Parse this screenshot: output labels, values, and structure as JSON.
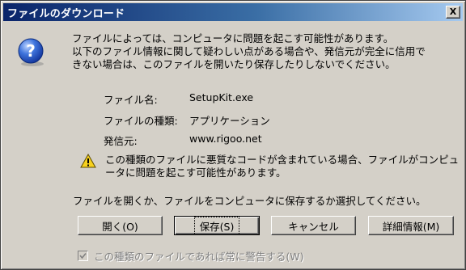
{
  "window": {
    "title": "ファイルのダウンロード",
    "close_label": "X"
  },
  "message": {
    "lines": [
      "ファイルによっては、コンピュータに問題を起こす可能性があります。",
      "以下のファイル情報に関して疑わしい点がある場合や、発信元が完全に信用で",
      "きない場合は、このファイルを開いたり保存したりしないでください。"
    ]
  },
  "file_info": {
    "name_label": "ファイル名:",
    "name_value": "SetupKit.exe",
    "type_label": "ファイルの種類:",
    "type_value": "アプリケーション",
    "source_label": "発信元:",
    "source_value": "www.rigoo.net"
  },
  "warning": {
    "lines": [
      "この種類のファイルに悪質なコードが含まれている場合、ファイルがコンピュ",
      "ータに問題を起こす可能性があります。"
    ]
  },
  "prompt": "ファイルを開くか、ファイルをコンピュータに保存するか選択してください。",
  "buttons": {
    "open": "開く(O)",
    "save": "保存(S)",
    "cancel": "キャンセル",
    "details": "詳細情報(M)"
  },
  "checkbox": {
    "label": "この種類のファイルであれば常に警告する(W)",
    "checked": true,
    "disabled": true
  },
  "icons": {
    "question": "question-icon",
    "warning": "warning-icon",
    "checkmark": "checkmark-icon"
  },
  "colors": {
    "title_start": "#0a246a",
    "title_end": "#a6caf0",
    "face": "#d4d0c8",
    "question_blue": "#1f4fb5",
    "warning_yellow": "#f7d11e"
  }
}
